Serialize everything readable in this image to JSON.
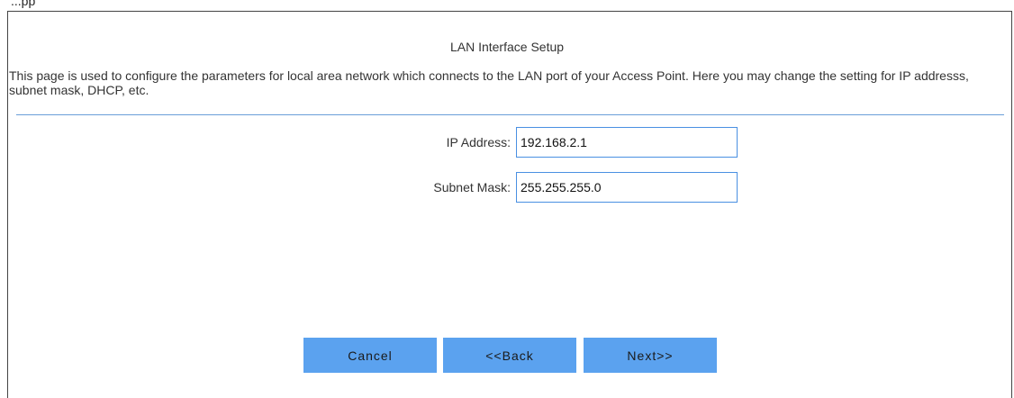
{
  "top_label": "...pp",
  "title": "LAN Interface Setup",
  "description": "This page is used to configure the parameters for local area network which connects to the LAN port of your Access Point. Here you may change the setting for IP addresss, subnet mask, DHCP, etc.",
  "fields": [
    {
      "label": "IP Address:",
      "value": "192.168.2.1"
    },
    {
      "label": "Subnet Mask:",
      "value": "255.255.255.0"
    }
  ],
  "buttons": {
    "cancel": "Cancel",
    "back": "<<Back",
    "next": "Next>>"
  },
  "colors": {
    "accent": "#5ba2ef",
    "divider": "#6a9fd8",
    "input_border": "#4a90e2"
  }
}
